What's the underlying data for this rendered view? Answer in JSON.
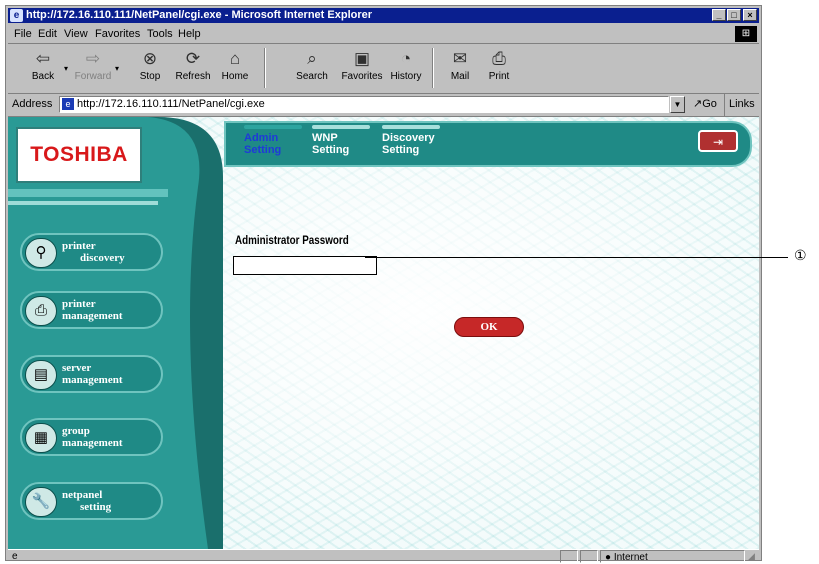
{
  "window": {
    "title": "http://172.16.110.111/NetPanel/cgi.exe - Microsoft Internet Explorer",
    "min_label": "_",
    "max_label": "□",
    "close_label": "×"
  },
  "menu": {
    "items": [
      "File",
      "Edit",
      "View",
      "Favorites",
      "Tools",
      "Help"
    ]
  },
  "toolbar": {
    "back": "Back",
    "forward": "Forward",
    "stop": "Stop",
    "refresh": "Refresh",
    "home": "Home",
    "search": "Search",
    "favorites": "Favorites",
    "history": "History",
    "mail": "Mail",
    "print": "Print"
  },
  "address": {
    "label": "Address",
    "url": "http://172.16.110.111/NetPanel/cgi.exe",
    "go": "Go",
    "links": "Links"
  },
  "page": {
    "logo": "TOSHIBA",
    "tabs": [
      {
        "line1": "Admin",
        "line2": "Setting",
        "active": true
      },
      {
        "line1": "WNP",
        "line2": "Setting",
        "active": false
      },
      {
        "line1": "Discovery",
        "line2": "Setting",
        "active": false
      }
    ],
    "nav": [
      {
        "line1": "printer",
        "line2": "discovery",
        "icon": "binoculars-icon"
      },
      {
        "line1": "printer",
        "line2": "management",
        "icon": "printer-icon"
      },
      {
        "line1": "server",
        "line2": "management",
        "icon": "server-icon"
      },
      {
        "line1": "group",
        "line2": "management",
        "icon": "group-icon"
      },
      {
        "line1": "netpanel",
        "line2": "setting",
        "icon": "wrench-icon"
      }
    ],
    "password_label": "Administrator Password",
    "password_value": "",
    "ok_label": "OK"
  },
  "statusbar": {
    "zone": "Internet"
  },
  "annotation": {
    "callout": "①"
  }
}
